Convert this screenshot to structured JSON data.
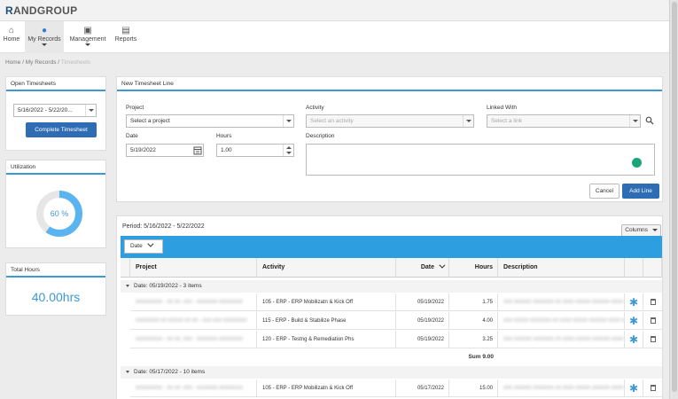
{
  "app": {
    "logo_mark": "R",
    "logo_text": "ANDGROUP"
  },
  "nav": [
    {
      "label": "Home",
      "icon": "home-icon"
    },
    {
      "label": "My Records",
      "icon": "user-icon"
    },
    {
      "label": "Management",
      "icon": "briefcase-icon"
    },
    {
      "label": "Reports",
      "icon": "book-icon"
    }
  ],
  "breadcrumb": {
    "home": "Home",
    "my_records": "My Records",
    "current": "Timesheets"
  },
  "open_timesheets": {
    "title": "Open Timesheets",
    "selected": "5/16/2022 - 5/22/20...",
    "complete_button": "Complete Timesheet"
  },
  "utilization": {
    "title": "Utilization",
    "value_label": "60 %",
    "fraction": 0.6
  },
  "total_hours": {
    "title": "Total Hours",
    "value": "40.00hrs"
  },
  "new_line": {
    "title": "New Timesheet Line",
    "project_label": "Project",
    "project_placeholder": "Select a project",
    "activity_label": "Activity",
    "activity_placeholder": "Select an activity",
    "linked_label": "Linked With",
    "linked_placeholder": "Select a link",
    "date_label": "Date",
    "date_value": "5/19/2022",
    "hours_label": "Hours",
    "hours_value": "1.00",
    "description_label": "Description",
    "cancel_button": "Cancel",
    "add_button": "Add Line"
  },
  "grid": {
    "period": "Period: 5/16/2022 - 5/22/2022",
    "columns_button": "Columns",
    "group_by_chip": "Date",
    "headers": {
      "project": "Project",
      "activity": "Activity",
      "date": "Date",
      "hours": "Hours",
      "description": "Description"
    },
    "groups": [
      {
        "label": "Date: 05/19/2022 - 3 items",
        "rows": [
          {
            "project": "######### - ## ##. ### - ####### ########",
            "activity": "105 - ERP - ERP Mobilizatn & Kick Off",
            "date": "05/19/2022",
            "hours": "1.75",
            "description": "### ###### ####### ## #### ##### ###### #### ## ###"
          },
          {
            "project": "######## ## ##### ## ## - ### ### ########",
            "activity": "115 - ERP - Build & Stabilize Phase",
            "date": "05/19/2022",
            "hours": "4.00",
            "description": "### ##### ####### ## #### ##### ###### #### ## ###"
          },
          {
            "project": "######### - ## ##. ### - ####### ########",
            "activity": "120 - ERP - Testng & Remediation Phs",
            "date": "05/19/2022",
            "hours": "3.25",
            "description": "### ###### ####### ## #### ##### ###### #### ## ###"
          }
        ],
        "sum": "Sum 9.00"
      },
      {
        "label": "Date: 05/17/2022 - 10 items",
        "rows": [
          {
            "project": "######### - ## ##. ### - ####### ########",
            "activity": "105 - ERP - ERP Mobilizatn & Kick Off",
            "date": "05/17/2022",
            "hours": "15.00",
            "description": "### ###### ####### ## #### ##### ###### #### ## ###"
          }
        ]
      }
    ]
  }
}
